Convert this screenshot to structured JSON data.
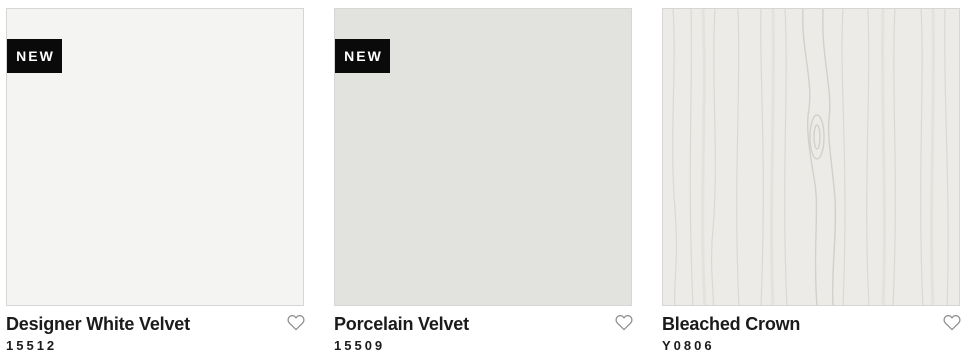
{
  "products": [
    {
      "badge": "NEW",
      "name": "Designer White Velvet",
      "code": "15512",
      "swatch_color": "#f4f5f2",
      "favorite_icon": "heart-outline-icon"
    },
    {
      "badge": "NEW",
      "name": "Porcelain Velvet",
      "code": "15509",
      "swatch_color": "#e2e3de",
      "favorite_icon": "heart-outline-icon"
    },
    {
      "name": "Bleached Crown",
      "code": "Y0806",
      "swatch_color": "#ecebe7",
      "swatch_pattern": "woodgrain",
      "favorite_icon": "heart-outline-icon"
    }
  ],
  "colors": {
    "badge_bg": "#0a0a0a",
    "text": "#1b1b1b"
  }
}
